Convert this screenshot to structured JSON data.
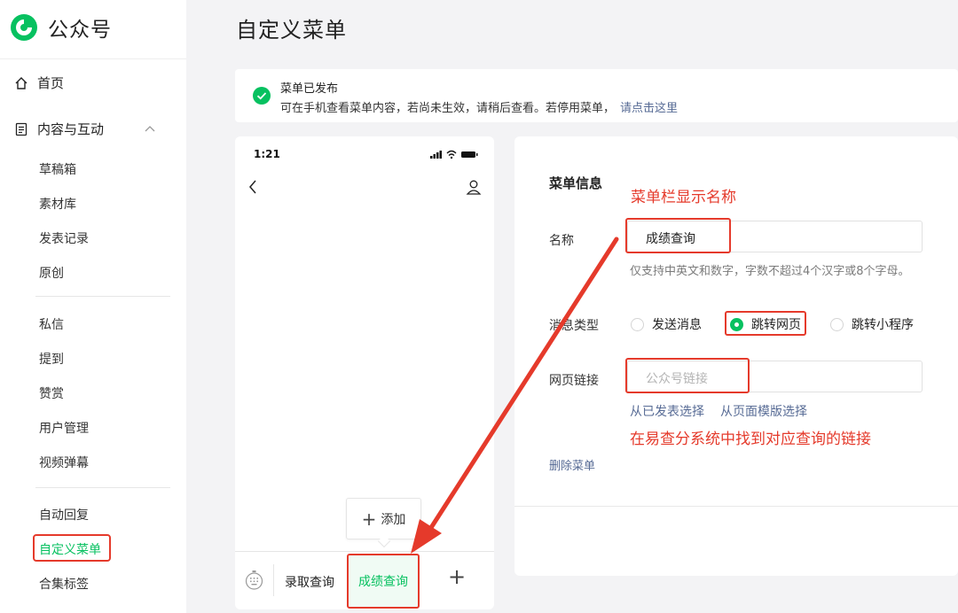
{
  "app": {
    "name": "公众号"
  },
  "sidebar": {
    "home": "首页",
    "content_section": "内容与互动",
    "items": [
      {
        "label": "草稿箱"
      },
      {
        "label": "素材库"
      },
      {
        "label": "发表记录"
      },
      {
        "label": "原创"
      },
      {
        "label": "私信"
      },
      {
        "label": "提到"
      },
      {
        "label": "赞赏"
      },
      {
        "label": "用户管理"
      },
      {
        "label": "视频弹幕"
      },
      {
        "label": "自动回复"
      },
      {
        "label": "自定义菜单",
        "active": true
      },
      {
        "label": "合集标签"
      }
    ]
  },
  "header": {
    "title": "自定义菜单"
  },
  "notice": {
    "title": "菜单已发布",
    "desc": "可在手机查看菜单内容，若尚未生效，请稍后查看。若停用菜单，",
    "link": "请点击这里"
  },
  "phone": {
    "time": "1:21",
    "add_popup": "添加",
    "menu_items": [
      "录取查询",
      "成绩查询"
    ],
    "add_symbol": "+"
  },
  "editor": {
    "section_title": "菜单信息",
    "annotation_name": "菜单栏显示名称",
    "name_label": "名称",
    "name_value": "成绩查询",
    "name_hint": "仅支持中英文和数字，字数不超过4个汉字或8个字母。",
    "msg_type_label": "消息类型",
    "msg_type_options": [
      {
        "label": "发送消息",
        "selected": false
      },
      {
        "label": "跳转网页",
        "selected": true
      },
      {
        "label": "跳转小程序",
        "selected": false
      }
    ],
    "url_label": "网页链接",
    "url_placeholder": "公众号链接",
    "select_published": "从已发表选择",
    "select_template": "从页面模版选择",
    "annotation_url": "在易查分系统中找到对应查询的链接",
    "delete": "删除菜单"
  },
  "colors": {
    "accent": "#07c160",
    "annotation": "#e53a2b",
    "link": "#576b95"
  }
}
